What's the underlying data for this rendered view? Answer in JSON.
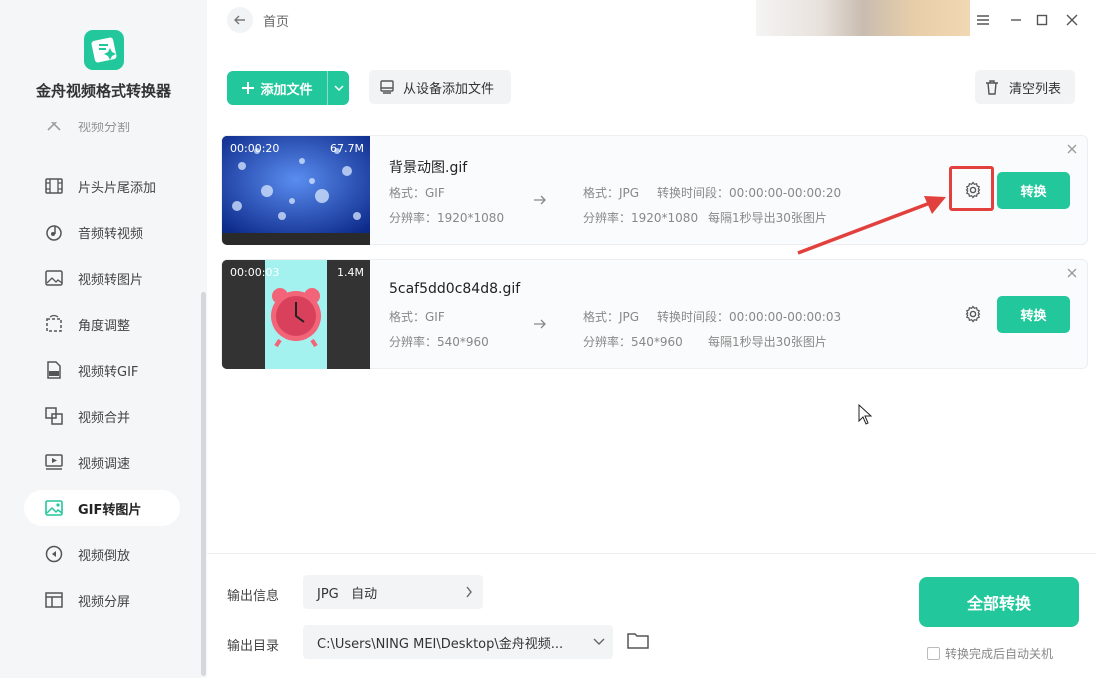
{
  "app": {
    "title": "金舟视频格式转换器"
  },
  "sidebar": {
    "items": [
      {
        "label": "视频分割",
        "icon": "cut-icon"
      },
      {
        "label": "片头片尾添加",
        "icon": "film-icon"
      },
      {
        "label": "音频转视频",
        "icon": "music-note-icon"
      },
      {
        "label": "视频转图片",
        "icon": "image-icon"
      },
      {
        "label": "角度调整",
        "icon": "rotate-icon"
      },
      {
        "label": "视频转GIF",
        "icon": "gif-file-icon"
      },
      {
        "label": "视频合并",
        "icon": "merge-icon"
      },
      {
        "label": "视频调速",
        "icon": "speed-icon"
      },
      {
        "label": "GIF转图片",
        "icon": "gif-image-icon",
        "active": true
      },
      {
        "label": "视频倒放",
        "icon": "reverse-icon"
      },
      {
        "label": "视频分屏",
        "icon": "split-screen-icon"
      }
    ]
  },
  "topbar": {
    "breadcrumb": "首页"
  },
  "toolbar": {
    "add_file": "添加文件",
    "add_from_device": "从设备添加文件",
    "clear_list": "清空列表"
  },
  "files": [
    {
      "name": "背景动图.gif",
      "duration": "00:00:20",
      "size": "67.7M",
      "src_format": "格式：GIF",
      "src_resolution": "分辨率：1920*1080",
      "dst_format": "格式：JPG",
      "dst_resolution": "分辨率：1920*1080",
      "time_range": "转换时间段：00:00:00-00:00:20",
      "export_rule": "每隔1秒导出30张图片",
      "convert_label": "转换"
    },
    {
      "name": "5caf5dd0c84d8.gif",
      "duration": "00:00:03",
      "size": "1.4M",
      "src_format": "格式：GIF",
      "src_resolution": "分辨率：540*960",
      "dst_format": "格式：JPG",
      "dst_resolution": "分辨率：540*960",
      "time_range": "转换时间段：00:00:00-00:00:03",
      "export_rule": "每隔1秒导出30张图片",
      "convert_label": "转换"
    }
  ],
  "footer": {
    "output_info_label": "输出信息",
    "output_info_value": "JPG   自动",
    "output_dir_label": "输出目录",
    "output_dir_value": "C:\\Users\\NING MEI\\Desktop\\金舟视频...",
    "convert_all": "全部转换",
    "auto_shutdown": "转换完成后自动关机"
  },
  "colors": {
    "accent": "#22c79b",
    "highlight": "#e2403c"
  }
}
